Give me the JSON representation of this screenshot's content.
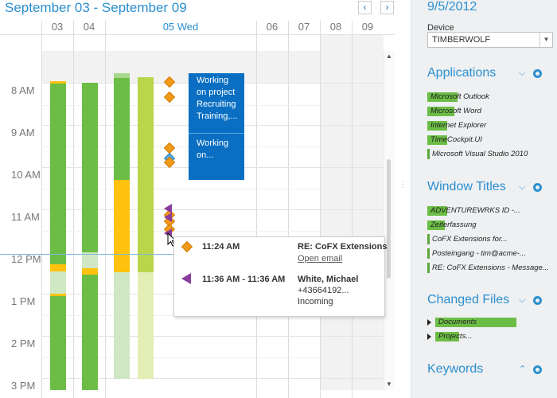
{
  "calendar": {
    "title": "September 03 - September 09",
    "prev_label": "‹",
    "next_label": "›",
    "days": [
      "03",
      "04",
      "05 Wed",
      "06",
      "07",
      "08",
      "09"
    ],
    "hours": [
      "8 AM",
      "9 AM",
      "10 AM",
      "11 AM",
      "12 PM",
      "1 PM",
      "2 PM",
      "3 PM"
    ],
    "events": [
      {
        "text": "Working on project Recruiting Training,..."
      },
      {
        "text": "Working on..."
      }
    ],
    "colors": {
      "app_green": "#6cbd45",
      "lime": "#b9d54a",
      "yellow": "#ffc20e",
      "accent": "#2b8fd0",
      "event_blue": "#0a6fc2",
      "diamond": "#f29a1a",
      "call": "#8a3d9c"
    },
    "tooltip": {
      "row1_time": "11:24 AM",
      "row1_subject": "RE: CoFX Extensions",
      "row1_link": "Open email",
      "row2_time": "11:36 AM - 11:36 AM",
      "row2_name": "White, Michael",
      "row2_number": "+43664192...",
      "row2_direction": "Incoming"
    }
  },
  "sidebar": {
    "date": "9/5/2012",
    "device_label": "Device",
    "device_value": "TIMBERWOLF",
    "sections": [
      {
        "title": "Applications",
        "collapse_icon": "chevron-down-icon",
        "settings_icon": "gear-icon",
        "items": [
          {
            "label": "Microsoft Outlook",
            "share": 0.25
          },
          {
            "label": "Microsoft Word",
            "share": 0.22
          },
          {
            "label": "Internet Explorer",
            "share": 0.16
          },
          {
            "label": "TimeCockpit.UI",
            "share": 0.16
          },
          {
            "label": "Microsoft Visual Studio 2010",
            "share": 0.03
          }
        ]
      },
      {
        "title": "Window Titles",
        "collapse_icon": "chevron-down-icon",
        "settings_icon": "gear-icon",
        "items": [
          {
            "label": "ADVENTUREWRKS ID -...",
            "share": 0.16
          },
          {
            "label": "Zeiterfassung",
            "share": 0.14
          },
          {
            "label": "CoFX Extensions for...",
            "share": 0.03
          },
          {
            "label": "Posteingang - tim@acme-...",
            "share": 0.03
          },
          {
            "label": "RE: CoFX Extensions - Message...",
            "share": 0.03
          }
        ]
      },
      {
        "title": "Changed Files",
        "collapse_icon": "chevron-down-icon",
        "settings_icon": "gear-icon",
        "items": [
          {
            "label": "Documents",
            "share": 0.73
          },
          {
            "label": "Projects...",
            "share": 0.22
          }
        ]
      },
      {
        "title": "Keywords",
        "collapse_icon": "chevron-up-icon",
        "settings_icon": "gear-icon",
        "items": []
      }
    ]
  }
}
